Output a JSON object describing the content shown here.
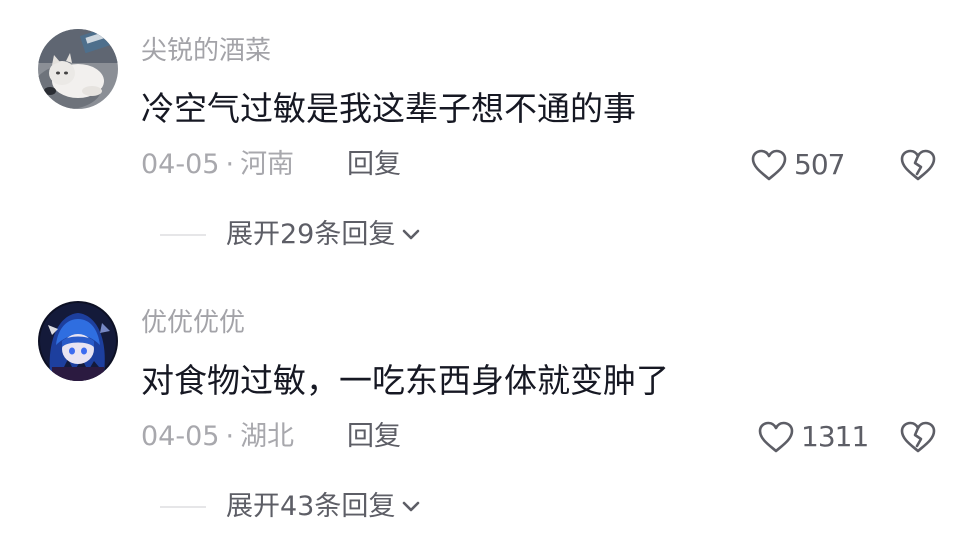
{
  "comments": [
    {
      "username": "尖锐的酒菜",
      "text": "冷空气过敏是我这辈子想不通的事",
      "date": "04-05",
      "separator": "·",
      "location": "河南",
      "reply_label": "回复",
      "likes": "507",
      "expand_label": "展开29条回复",
      "avatar_icon": "cat-avatar"
    },
    {
      "username": "优优优优",
      "text": "对食物过敏，一吃东西身体就变肿了",
      "date": "04-05",
      "separator": "·",
      "location": "湖北",
      "reply_label": "回复",
      "likes": "1311",
      "expand_label": "展开43条回复",
      "avatar_icon": "anime-character-avatar"
    }
  ],
  "icons": {
    "like": "heart-outline-icon",
    "dislike": "broken-heart-icon",
    "expand": "chevron-down-icon"
  },
  "colors": {
    "text_primary": "#161823",
    "text_secondary": "#a3a3a8",
    "text_action": "#5d5e66"
  }
}
